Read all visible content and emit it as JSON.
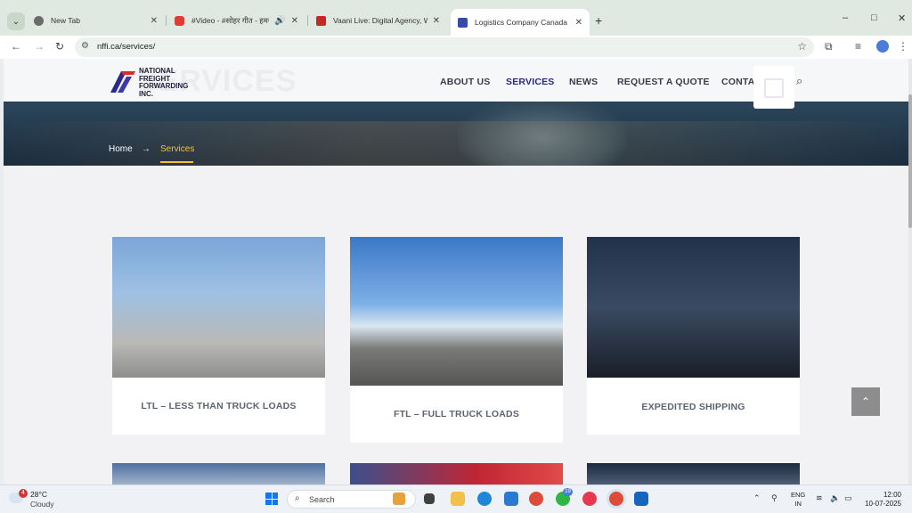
{
  "browser": {
    "tabs": [
      {
        "title": "New Tab",
        "favicon_color": "#6b6b6b"
      },
      {
        "title": "#Video - #सोहर गीत - हमरा",
        "favicon_color": "#e53935"
      },
      {
        "title": "Vaani Live: Digital Agency, Web",
        "favicon_color": "#c62828"
      },
      {
        "title": "Logistics Company Canada | LTL",
        "favicon_color": "#3949ab"
      }
    ],
    "url": "nffi.ca/services/",
    "new_tab_symbol": "+",
    "window_controls": [
      "–",
      "□",
      "✕"
    ]
  },
  "site": {
    "bg_title": "SERVICES",
    "logo": {
      "line1": "NATIONAL",
      "line2": "FREIGHT",
      "line3": "FORWARDING",
      "line4": "INC."
    },
    "nav": [
      "ABOUT US",
      "SERVICES",
      "NEWS",
      "REQUEST A QUOTE",
      "CONTACT US"
    ],
    "breadcrumb": {
      "home": "Home",
      "separator": "→",
      "current": "Services"
    },
    "cards": [
      {
        "label": "LTL – LESS THAN TRUCK LOADS"
      },
      {
        "label": "FTL – FULL TRUCK LOADS"
      },
      {
        "label": "EXPEDITED SHIPPING"
      }
    ],
    "accent": "#f0c23a",
    "nav_active_color": "#26288a"
  },
  "taskbar": {
    "weather_badge": "4",
    "temperature": "28°C",
    "condition": "Cloudy",
    "search_placeholder": "Search",
    "whatsapp_badge": "19",
    "language": {
      "line1": "ENG",
      "line2": "IN"
    },
    "time": "12:00",
    "date": "10-07-2025"
  }
}
